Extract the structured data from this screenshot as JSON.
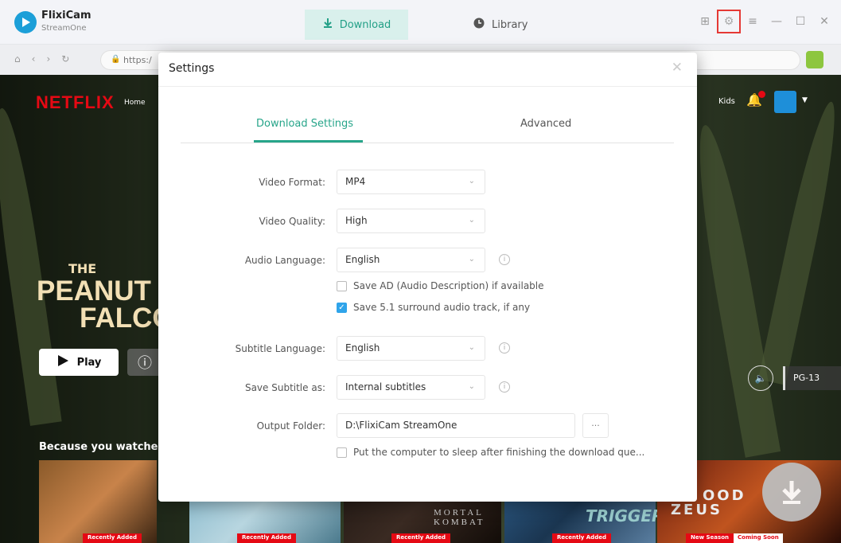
{
  "app": {
    "name": "FlixiCam",
    "subtitle": "StreamOne"
  },
  "titlebar": {
    "tabs": [
      {
        "label": "Download",
        "icon": "download-icon",
        "active": true
      },
      {
        "label": "Library",
        "icon": "library-icon",
        "active": false
      }
    ],
    "controls": [
      "grid-icon",
      "settings-icon",
      "menu-icon",
      "minimize-icon",
      "maximize-icon",
      "close-icon"
    ]
  },
  "browser": {
    "url": "https:/"
  },
  "netflix": {
    "logo": "NETFLIX",
    "nav_home": "Home",
    "kids": "Kids",
    "title_the": "THE",
    "title_line1": "PEANUT BU",
    "title_line2": "FALCO",
    "play_label": "Play",
    "rating": "PG-13",
    "row_title": "Because you watched",
    "thumbs": [
      {
        "badge": "Recently Added"
      },
      {
        "badge": "Recently Added"
      },
      {
        "badge": "Recently Added",
        "text": "MORTAL KOMBAT"
      },
      {
        "badge": "Recently Added",
        "text": "TRIGGER"
      },
      {
        "badge": "New Season",
        "extra": "Coming Soon",
        "text": "ZEUS",
        "text_top": "OOD"
      }
    ]
  },
  "settings": {
    "title": "Settings",
    "tabs": [
      "Download Settings",
      "Advanced"
    ],
    "active_tab": 0,
    "fields": {
      "video_format": {
        "label": "Video Format:",
        "value": "MP4"
      },
      "video_quality": {
        "label": "Video Quality:",
        "value": "High"
      },
      "audio_language": {
        "label": "Audio Language:",
        "value": "English"
      },
      "subtitle_language": {
        "label": "Subtitle Language:",
        "value": "English"
      },
      "save_subtitle": {
        "label": "Save Subtitle as:",
        "value": "Internal subtitles"
      },
      "output_folder": {
        "label": "Output Folder:",
        "value": "D:\\FlixiCam StreamOne",
        "button": "···"
      }
    },
    "checkboxes": {
      "save_ad": {
        "label": "Save AD (Audio Description) if available",
        "checked": false
      },
      "save_51": {
        "label": "Save 5.1 surround audio track, if any",
        "checked": true
      },
      "sleep": {
        "label": "Put the computer to sleep after finishing the download que...",
        "checked": false
      }
    }
  },
  "colors": {
    "accent": "#27a58a",
    "highlight": "#e53935",
    "checkbox": "#2fa4ea",
    "netflix_red": "#e50914"
  }
}
